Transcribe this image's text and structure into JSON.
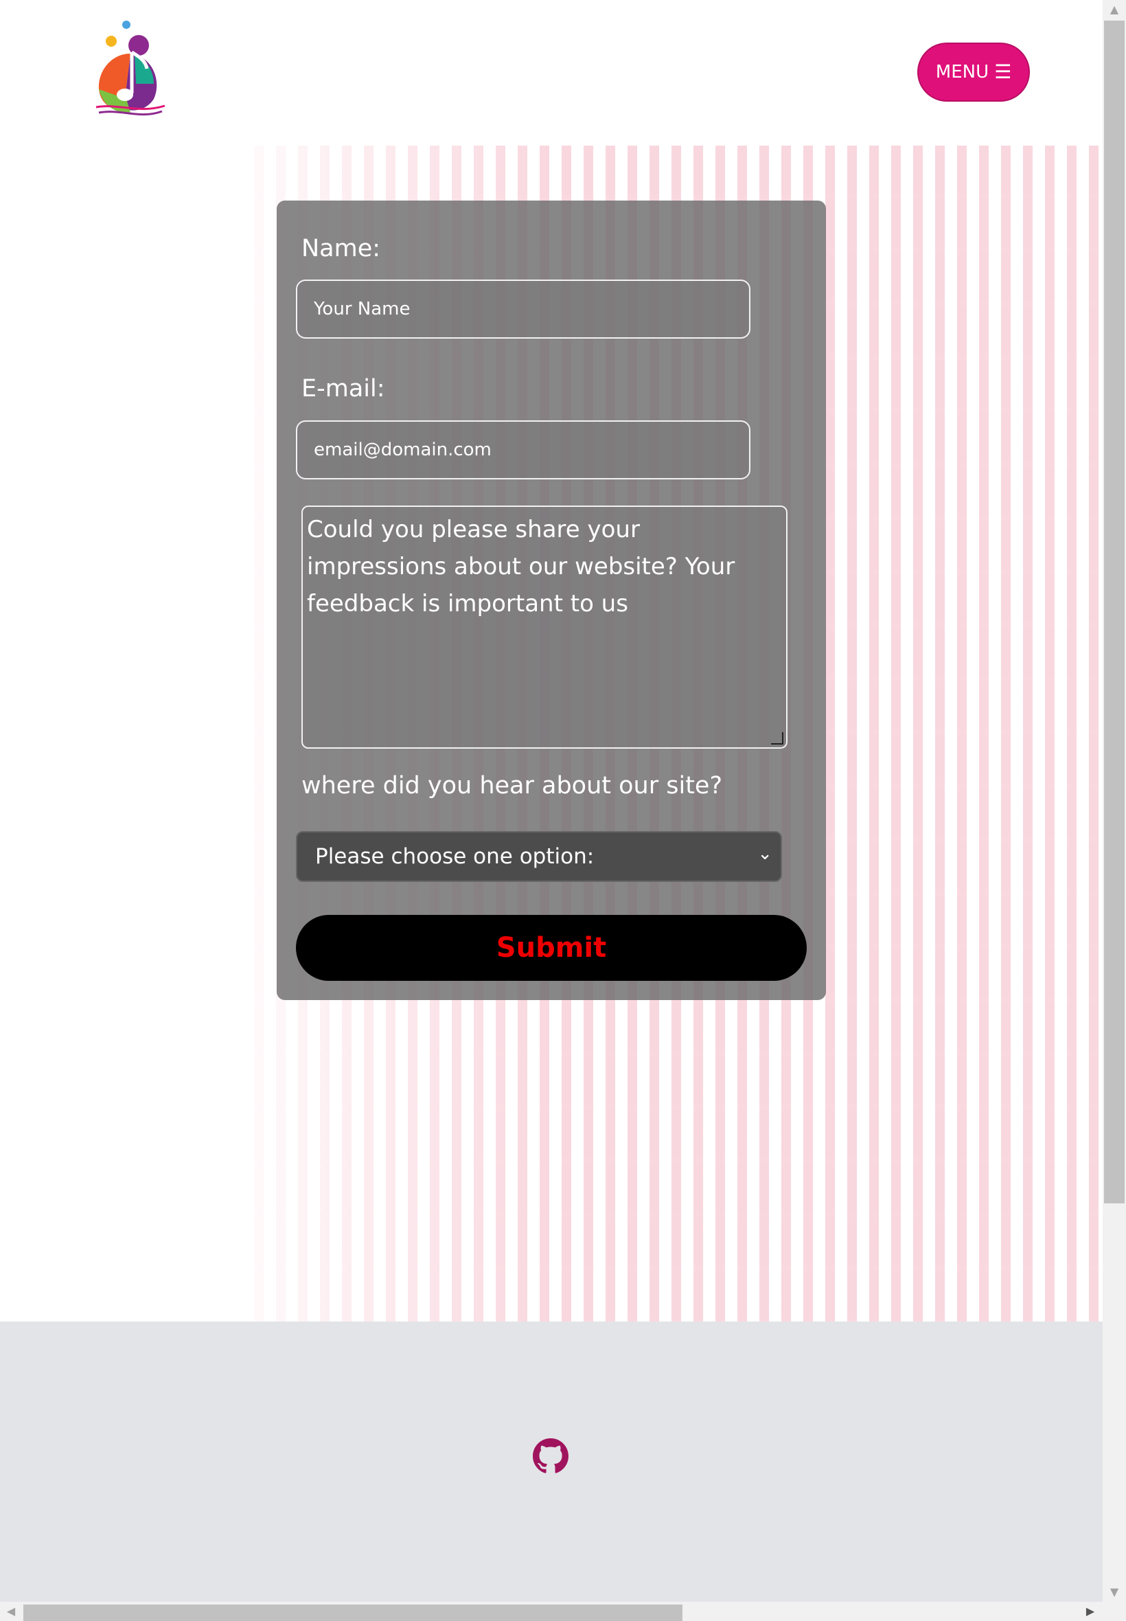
{
  "header": {
    "menu_label": "MENU",
    "menu_icon": "hamburger-icon",
    "logo_icon": "music-note-logo"
  },
  "form": {
    "name_label": "Name:",
    "name_placeholder": "Your Name",
    "email_label": "E-mail:",
    "email_placeholder": "email@domain.com",
    "feedback_text": "Could you please share your impressions about our website? Your feedback is important to us",
    "source_label": "where did you hear about our site?",
    "source_selected": "Please choose one option:",
    "submit_label": "Submit"
  },
  "footer": {
    "github_icon": "github-icon"
  },
  "colors": {
    "accent": "#e0107a",
    "submit_text": "#ee0000",
    "footer_bg": "#e3e4e8",
    "github": "#a0135d"
  }
}
